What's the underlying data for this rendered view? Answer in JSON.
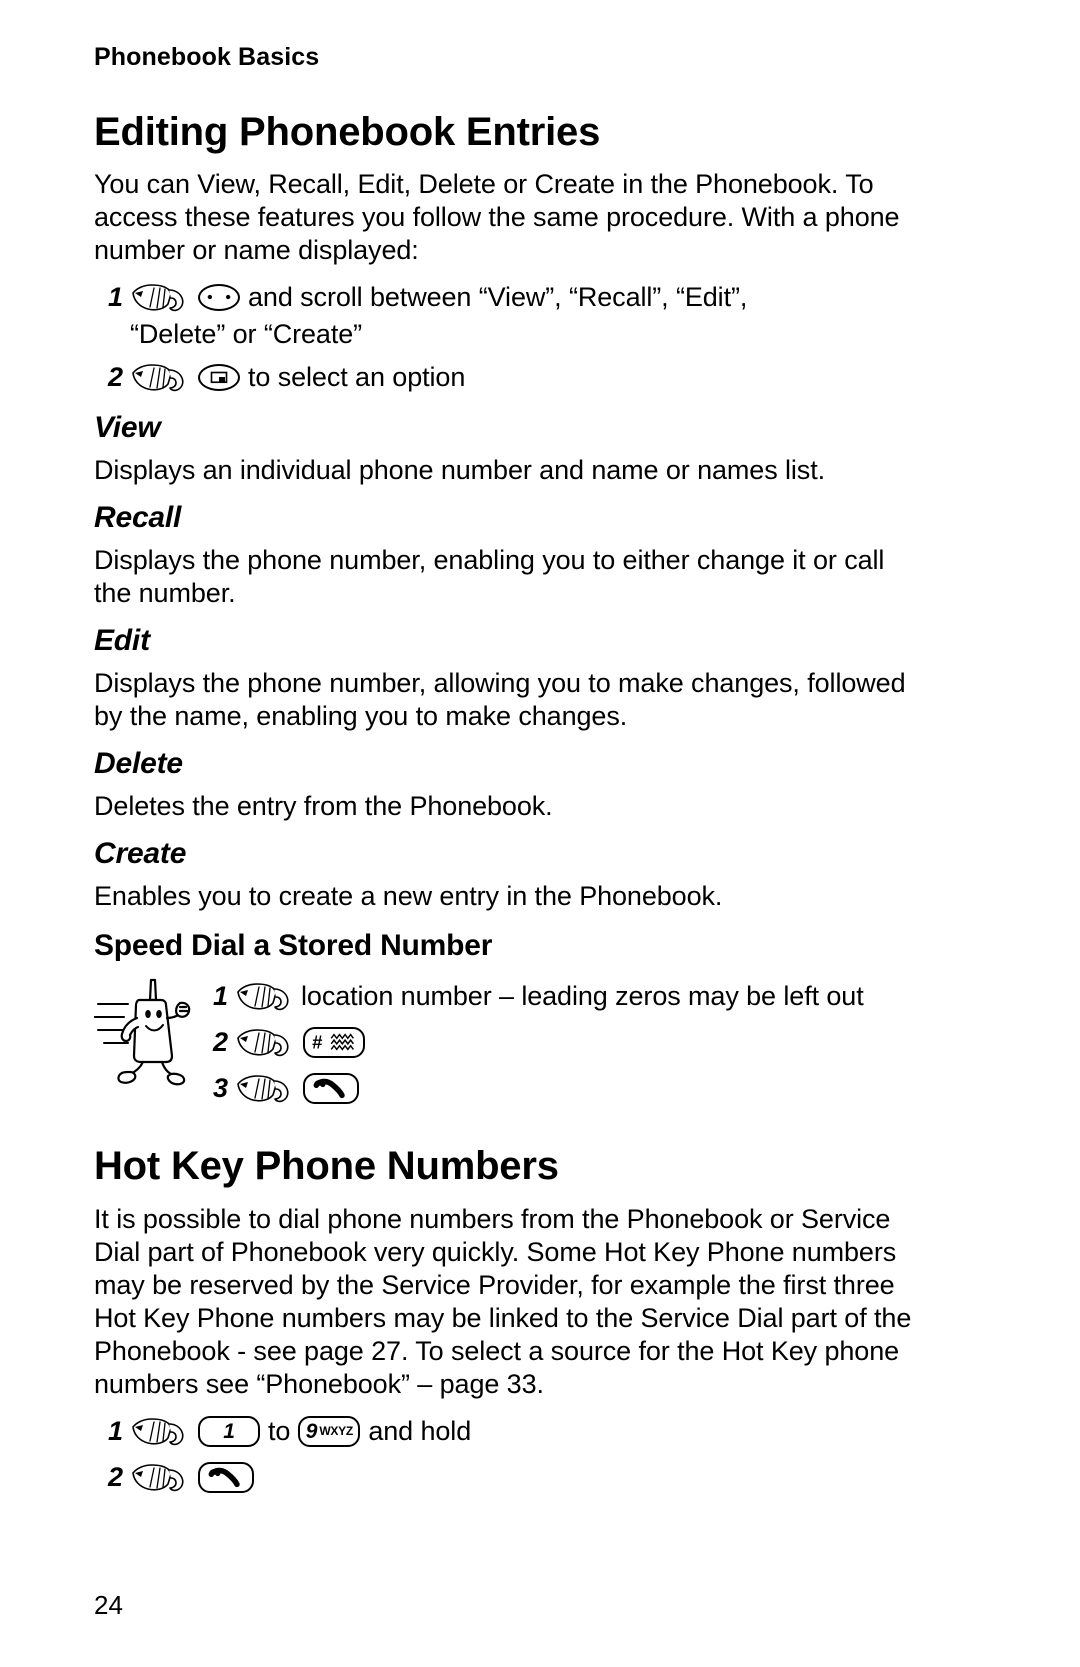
{
  "page": {
    "running_head": "Phonebook Basics",
    "folio": "24"
  },
  "sections": {
    "editing": {
      "heading": "Editing Phonebook Entries",
      "intro": "You can View, Recall, Edit, Delete or Create in the Phonebook. To access these features you follow the same procedure. With a phone number or name displayed:",
      "steps": [
        {
          "num": "1",
          "icon": "pointing-hand-icon",
          "key": "scroll-key",
          "text": "and scroll between “View”, “Recall”, “Edit”,",
          "continuation": "“Delete” or “Create”"
        },
        {
          "num": "2",
          "icon": "pointing-hand-icon",
          "key": "select-key",
          "text": "to select an option",
          "continuation": ""
        }
      ],
      "subsections": [
        {
          "title": "View",
          "body": "Displays an individual phone number and name or names list."
        },
        {
          "title": "Recall",
          "body": "Displays the phone number, enabling you to either change it or call the number."
        },
        {
          "title": "Edit",
          "body": "Displays the phone number, allowing you to make changes, followed by the name, enabling you to make changes."
        },
        {
          "title": "Delete",
          "body": "Deletes the entry from the Phonebook."
        },
        {
          "title": "Create",
          "body": "Enables you to create a new entry in the Phonebook."
        }
      ]
    },
    "speed_dial": {
      "heading": "Speed Dial a Stored Number",
      "illustration": "running-phone-character",
      "steps": [
        {
          "num": "1",
          "icon": "pointing-hand-icon",
          "key": "",
          "text": "location number – leading zeros may be left out"
        },
        {
          "num": "2",
          "icon": "pointing-hand-icon",
          "key": "hash-key",
          "key_label": "#",
          "text": ""
        },
        {
          "num": "3",
          "icon": "pointing-hand-icon",
          "key": "call-key",
          "text": ""
        }
      ]
    },
    "hot_key": {
      "heading": "Hot Key Phone Numbers",
      "body": "It is possible to dial phone numbers from the Phonebook or Service Dial part of Phonebook very quickly. Some Hot Key Phone numbers may be reserved by the Service Provider, for example the first three Hot Key Phone numbers may be linked to the Service Dial part of the Phonebook - see page 27. To select a source for the Hot Key phone numbers see “Phonebook” – page 33.",
      "steps": [
        {
          "num": "1",
          "icon": "pointing-hand-icon",
          "key_from_digit": "1",
          "between_text": "to",
          "key_to_digit": "9",
          "key_to_letters": "WXYZ",
          "trailing_text": "and hold"
        },
        {
          "num": "2",
          "icon": "pointing-hand-icon",
          "key": "call-key",
          "trailing_text": ""
        }
      ]
    }
  }
}
